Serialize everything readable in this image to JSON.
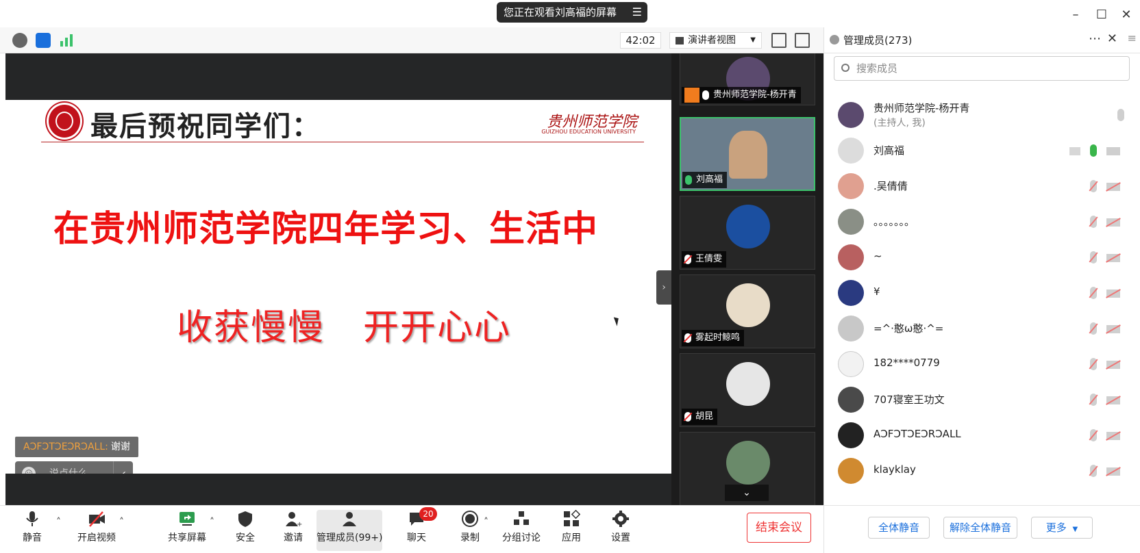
{
  "screen_share_banner": "您正在观看刘高福的屏幕",
  "toolbar": {
    "timer": "42:02",
    "view_mode": "演讲者视图"
  },
  "slide": {
    "title": "最后预祝同学们：",
    "school_name_cn": "贵州师范学院",
    "school_name_en": "GUIZHOU EDUCATION UNIVERSITY",
    "line1": "在贵州师范学院四年学习、生活中",
    "line2_a": "收获慢慢",
    "line2_b": "开开心心"
  },
  "chat_overlay": {
    "sender": "AↃFↃTↃEↃRↃALL:",
    "message": "谢谢",
    "input_placeholder": "说点什么..."
  },
  "video_tiles": [
    {
      "name": "贵州师范学院-杨开青",
      "muted": false,
      "host": true
    },
    {
      "name": "刘高福",
      "muted": false,
      "active": true
    },
    {
      "name": "王倩雯",
      "muted": true
    },
    {
      "name": "雾起时鲸鸣",
      "muted": true
    },
    {
      "name": "胡昆",
      "muted": true
    }
  ],
  "panel": {
    "title": "管理成员(273)",
    "search_placeholder": "搜索成员",
    "members": [
      {
        "name": "贵州师范学院-杨开青",
        "sub": "(主持人, 我)",
        "avatar_color": "#5b4a6e"
      },
      {
        "name": "刘高福",
        "sub": "",
        "avatar_color": "#dcdcdc"
      },
      {
        "name": ".吴倩倩",
        "sub": "",
        "avatar_color": "#e0a090"
      },
      {
        "name": "。。。。。。。",
        "sub": "",
        "avatar_color": "#8a8f86"
      },
      {
        "name": "~",
        "sub": "",
        "avatar_color": "#b86060"
      },
      {
        "name": "¥",
        "sub": "",
        "avatar_color": "#2a3a80"
      },
      {
        "name": "=^·憨ω憨·^=",
        "sub": "",
        "avatar_color": "#c8c8c8"
      },
      {
        "name": "182****0779",
        "sub": "",
        "avatar_color": "#f2f2f2"
      },
      {
        "name": "707寝室王功文",
        "sub": "",
        "avatar_color": "#4a4a4a"
      },
      {
        "name": "AↃFↃTↃEↃRↃALL",
        "sub": "",
        "avatar_color": "#222222"
      },
      {
        "name": "klayklay",
        "sub": "",
        "avatar_color": "#d08a30"
      }
    ],
    "mute_all": "全体静音",
    "unmute_all": "解除全体静音",
    "more": "更多"
  },
  "bottom": {
    "mute": "静音",
    "video": "开启视频",
    "share": "共享屏幕",
    "security": "安全",
    "invite": "邀请",
    "manage": "管理成员(99+)",
    "chat": "聊天",
    "chat_badge": "20",
    "record": "录制",
    "breakout": "分组讨论",
    "apps": "应用",
    "settings": "设置",
    "end": "结束会议"
  },
  "colors": {
    "accent": "#1a6fdc",
    "danger": "#e33333",
    "active_green": "#3cc26b"
  }
}
